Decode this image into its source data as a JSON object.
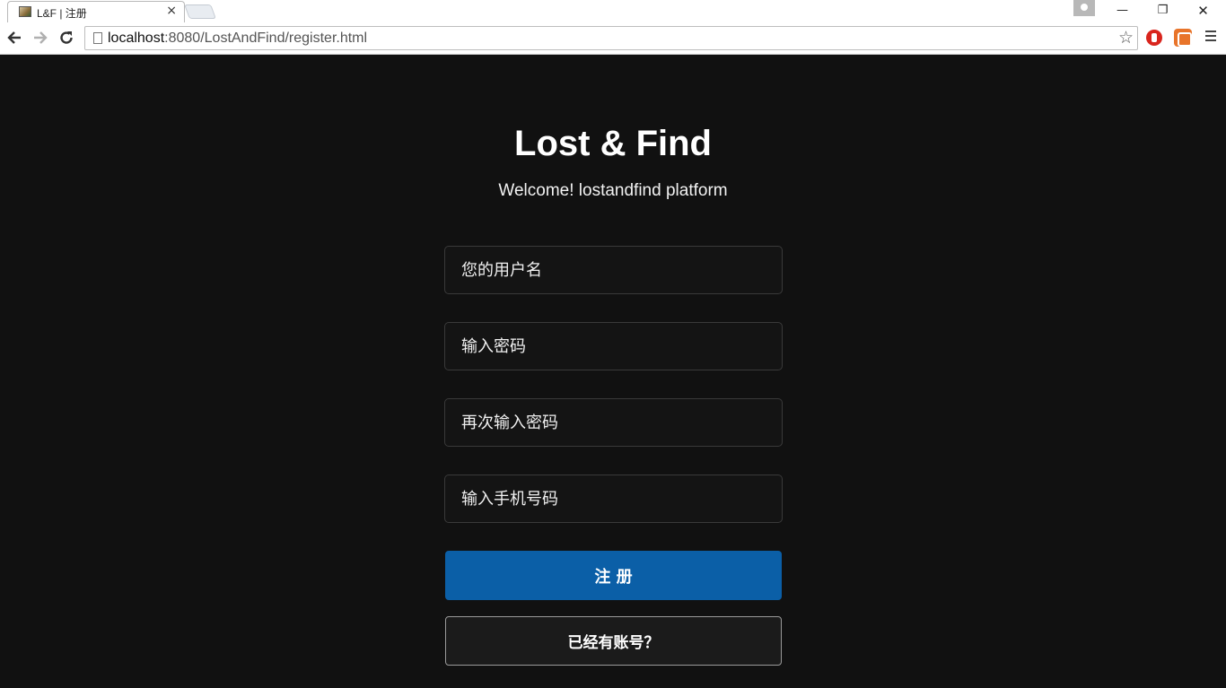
{
  "browser": {
    "tab_title": "L&F | 注册",
    "tab_close": "×",
    "url_host": "localhost",
    "url_path": ":8080/LostAndFind/register.html",
    "back_icon": "arrow-left-icon",
    "forward_icon": "arrow-right-icon",
    "reload_icon": "reload-icon",
    "bookmark_icon": "star-icon",
    "window_controls": {
      "minimize": "—",
      "maximize": "❐",
      "close": "✕"
    }
  },
  "page": {
    "title": "Lost & Find",
    "subtitle": "Welcome! lostandfind platform",
    "fields": {
      "username_placeholder": "您的用户名",
      "password_placeholder": "输入密码",
      "confirm_password_placeholder": "再次输入密码",
      "phone_placeholder": "输入手机号码"
    },
    "register_button": "注 册",
    "login_link_button": "已经有账号？"
  },
  "colors": {
    "background": "#111111",
    "primary_button": "#0b5fa7"
  }
}
